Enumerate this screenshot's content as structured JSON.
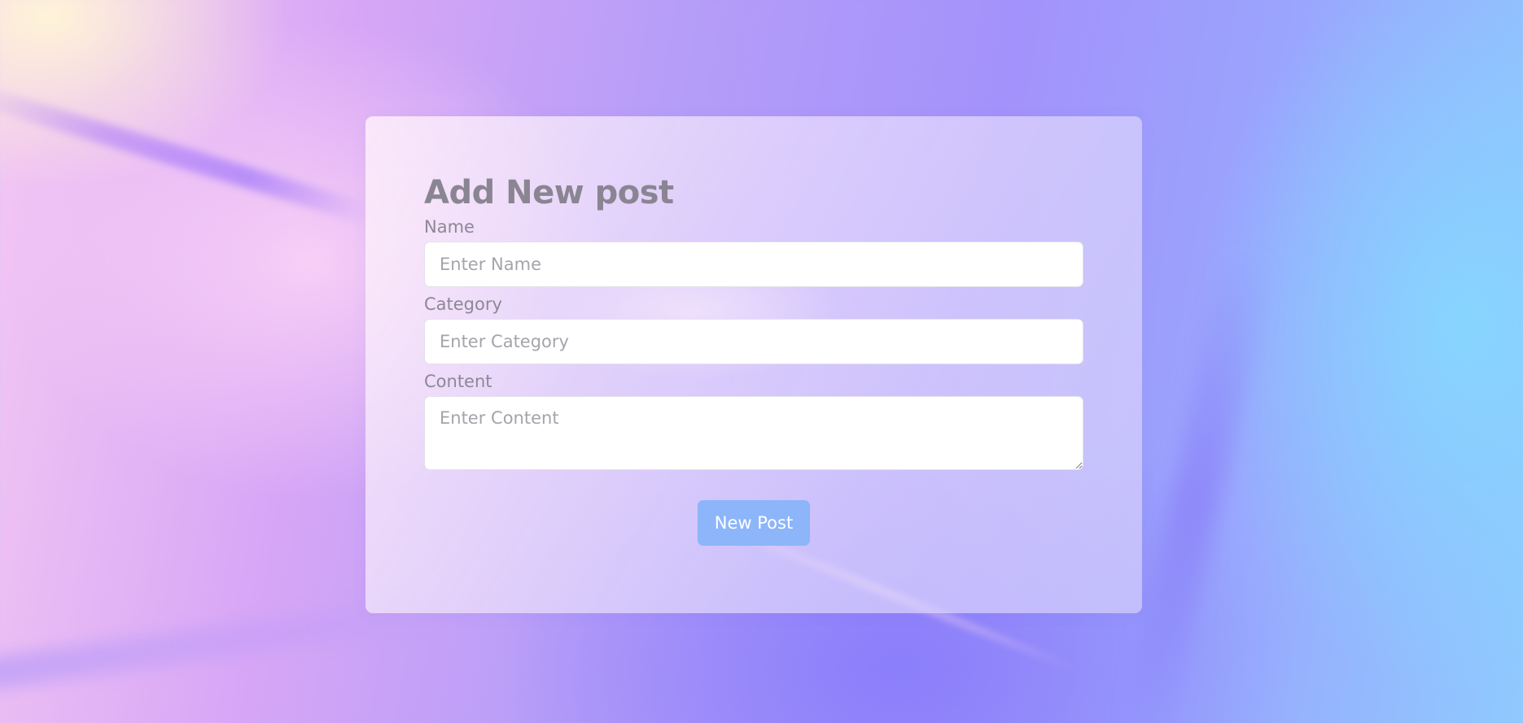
{
  "form": {
    "title": "Add New post",
    "name": {
      "label": "Name",
      "placeholder": "Enter Name",
      "value": ""
    },
    "category": {
      "label": "Category",
      "placeholder": "Enter Category",
      "value": ""
    },
    "content": {
      "label": "Content",
      "placeholder": "Enter Content",
      "value": ""
    },
    "submit_label": "New Post"
  },
  "colors": {
    "button": "#8cb5fa",
    "title_text": "#8a8592",
    "label_text": "#8d8895",
    "placeholder_text": "#a6a3ab"
  }
}
